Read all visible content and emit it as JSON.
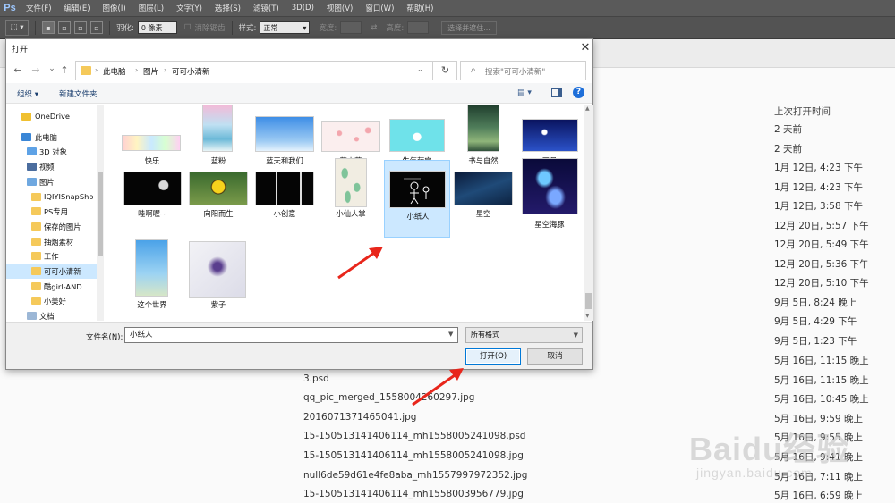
{
  "app": {
    "logo": "Ps",
    "menu": [
      "文件(F)",
      "编辑(E)",
      "图像(I)",
      "图层(L)",
      "文字(Y)",
      "选择(S)",
      "滤镜(T)",
      "3D(D)",
      "视图(V)",
      "窗口(W)",
      "帮助(H)"
    ]
  },
  "options_bar": {
    "feather_label": "羽化:",
    "feather_value": "0 像素",
    "antialias_label": "消除锯齿",
    "style_label": "样式:",
    "style_value": "正常",
    "width_label": "宽度:",
    "height_label": "高度:",
    "select_mask_button": "选择并遮住..."
  },
  "background": {
    "column_header": "上次打开时间",
    "dates": [
      "2 天前",
      "2 天前",
      "1月 12日, 4:23 下午",
      "1月 12日, 4:23 下午",
      "1月 12日, 3:58 下午",
      "12月 20日, 5:57 下午",
      "12月 20日, 5:49 下午",
      "12月 20日, 5:36 下午",
      "12月 20日, 5:10 下午",
      "9月 5日, 8:24 晚上",
      "9月 5日, 4:29 下午",
      "9月 5日, 1:23 下午",
      "5月 16日, 11:15 晚上",
      "5月 16日, 11:15 晚上",
      "5月 16日, 10:45 晚上",
      "5月 16日, 9:59 晚上",
      "5月 16日, 9:55 晚上",
      "5月 16日, 9:41 晚上",
      "5月 16日, 7:11 晚上",
      "5月 16日, 6:59 晚上"
    ],
    "files": [
      "3.psd",
      "qq_pic_merged_1558004260297.jpg",
      "2016071371465041.jpg",
      "15-150513141406114_mh1558005241098.psd",
      "15-150513141406114_mh1558005241098.jpg",
      "null6de59d61e4fe8aba_mh1557997972352.jpg",
      "15-150513141406114_mh1558003956779.jpg"
    ]
  },
  "dialog": {
    "title": "打开",
    "close": "✕",
    "nav": {
      "back": "←",
      "forward": "→",
      "recent": "⌄",
      "up": "↑"
    },
    "breadcrumb": [
      "此电脑",
      "图片",
      "可可小清新"
    ],
    "search_placeholder": "搜索\"可可小清新\"",
    "toolbar": {
      "organize": "组织 ▾",
      "new_folder": "新建文件夹",
      "help": "?"
    },
    "nav_pane": [
      {
        "label": "OneDrive",
        "icon": "cloud"
      },
      {
        "label": "此电脑",
        "icon": "pc"
      },
      {
        "label": "3D 对象",
        "icon": "obj"
      },
      {
        "label": "视频",
        "icon": "video"
      },
      {
        "label": "图片",
        "icon": "pic"
      },
      {
        "label": "IQIYISnapSho",
        "icon": "folder"
      },
      {
        "label": "PS专用",
        "icon": "folder"
      },
      {
        "label": "保存的图片",
        "icon": "folder"
      },
      {
        "label": "抽烟素材",
        "icon": "folder"
      },
      {
        "label": "工作",
        "icon": "folder"
      },
      {
        "label": "可可小清新",
        "icon": "folder"
      },
      {
        "label": "酷girl-AND",
        "icon": "folder"
      },
      {
        "label": "小美好",
        "icon": "folder"
      },
      {
        "label": "文档",
        "icon": "doc"
      }
    ],
    "files": [
      {
        "name": "快乐"
      },
      {
        "name": "蓝粉"
      },
      {
        "name": "蓝天和我们"
      },
      {
        "name": "萌小花"
      },
      {
        "name": "生气萌宝"
      },
      {
        "name": "书与自然"
      },
      {
        "name": "四月"
      },
      {
        "name": "哇啊喔~"
      },
      {
        "name": "向阳而生"
      },
      {
        "name": "小创意"
      },
      {
        "name": "小仙人掌"
      },
      {
        "name": "小纸人"
      },
      {
        "name": "星空"
      },
      {
        "name": "星空海豚"
      },
      {
        "name": "这个世界"
      },
      {
        "name": "紫子"
      }
    ],
    "filename_label": "文件名(N):",
    "filename_value": "小纸人",
    "filetype": "所有格式",
    "open_button": "打开(O)",
    "cancel_button": "取消"
  },
  "watermark": {
    "text": "Baidu经验",
    "url": "jingyan.baidu.com"
  },
  "colors": {
    "accent": "#0078d7",
    "selection": "#cce8ff",
    "arrow": "#e8261b"
  }
}
